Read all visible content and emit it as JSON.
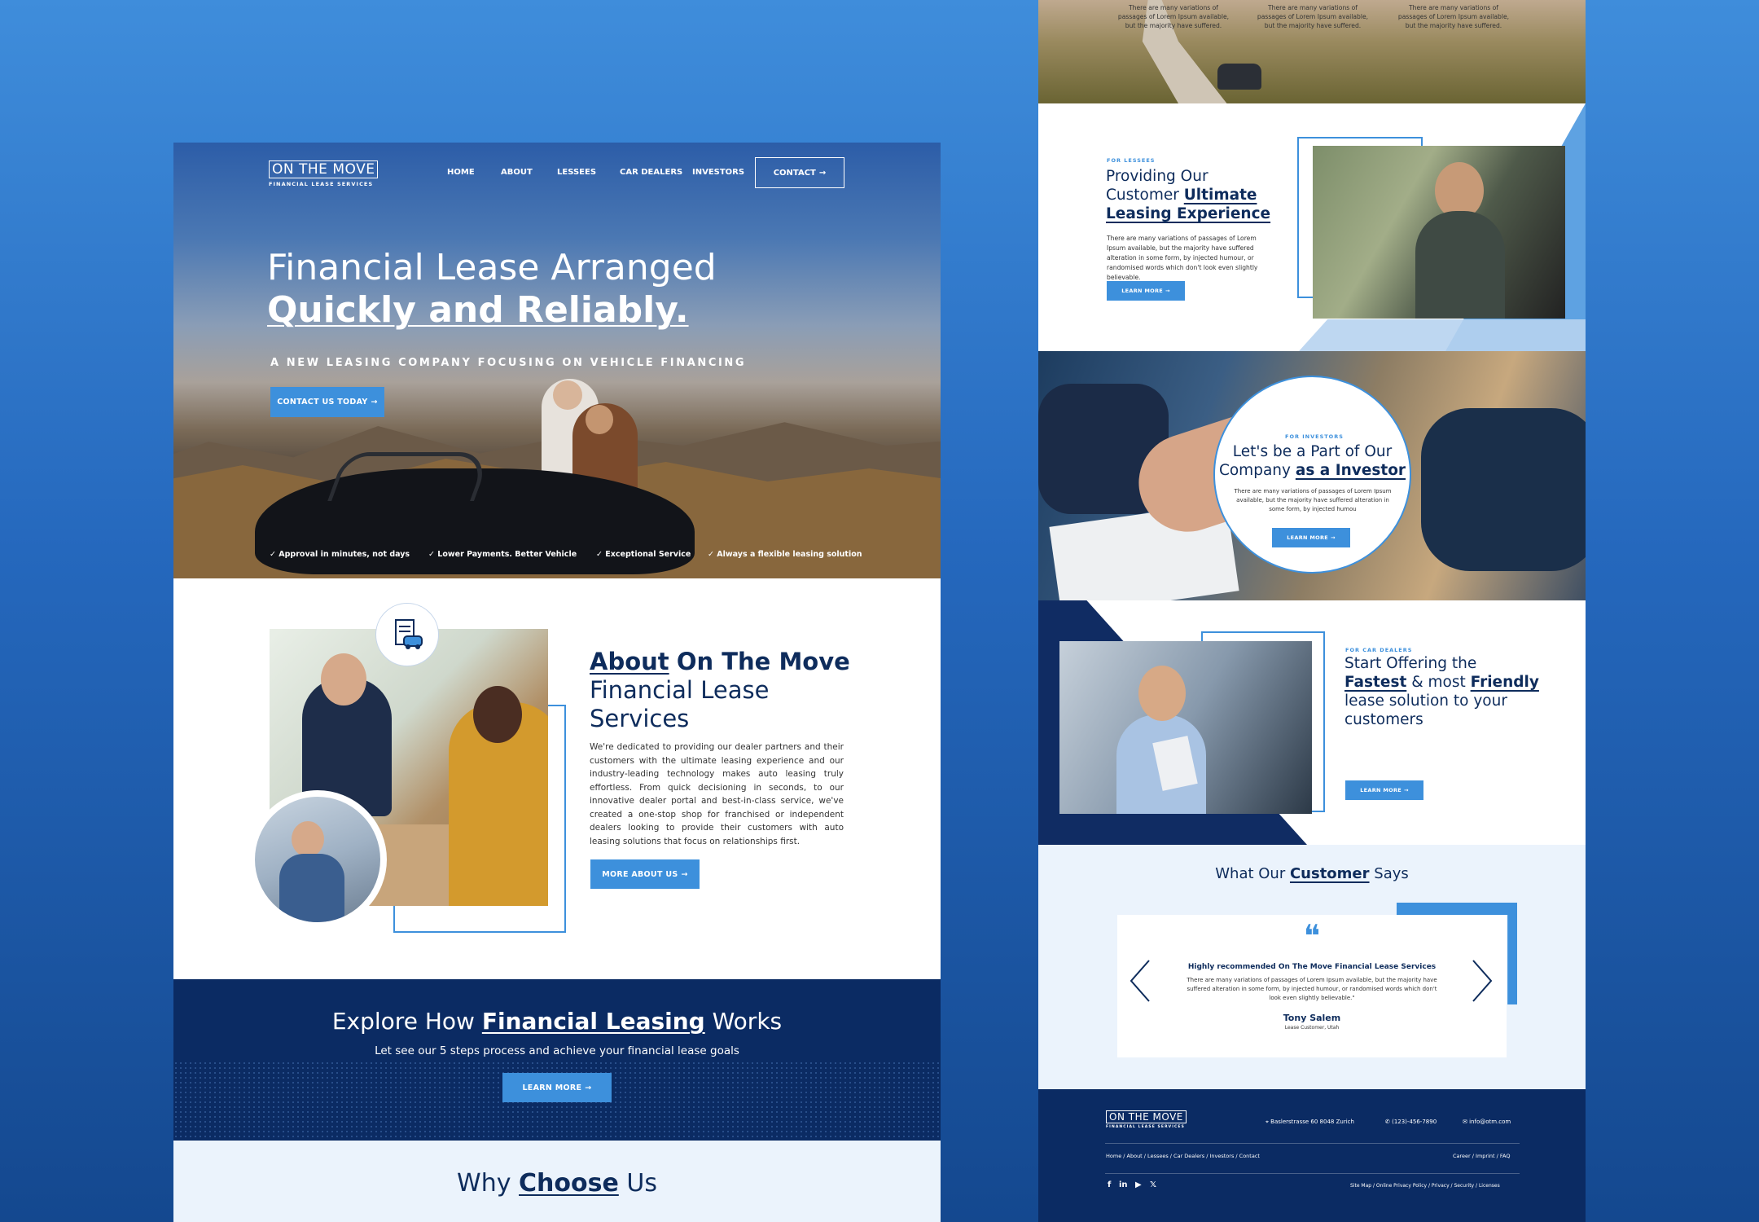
{
  "left": {
    "logo": {
      "title": "ON THE MOVE",
      "subtitle": "FINANCIAL LEASE SERVICES"
    },
    "nav": [
      "HOME",
      "ABOUT",
      "LESSEES",
      "CAR DEALERS",
      "INVESTORS"
    ],
    "contact": "CONTACT",
    "hero": {
      "line1": "Financial Lease Arranged",
      "line2": "Quickly and Reliably.",
      "tagline": "A NEW LEASING COMPANY FOCUSING ON VEHICLE FINANCING",
      "cta": "CONTACT US TODAY",
      "features": [
        "Approval in minutes, not days",
        "Lower Payments. Better Vehicle",
        "Exceptional Service",
        "Always a flexible leasing solution"
      ]
    },
    "about": {
      "title_hl": "About",
      "title_rest": "On The Move",
      "title_line2": "Financial Lease",
      "title_line3": "Services",
      "text": "We're dedicated to providing our dealer partners and their customers with the ultimate leasing experience and our industry-leading technology makes auto leasing truly effortless. From quick decisioning in seconds, to our innovative dealer portal and best-in-class service, we've created a one-stop shop for franchised or independent dealers looking to provide their customers with auto leasing solutions that focus on relationships first.",
      "button": "MORE ABOUT US"
    },
    "explore": {
      "pre": "Explore How",
      "hl": "Financial Leasing",
      "post": "Works",
      "subtitle": "Let see our 5 steps process and achieve your financial lease goals",
      "button": "LEARN MORE"
    },
    "why": {
      "pre": "Why",
      "hl": "Choose",
      "post": "Us"
    }
  },
  "right": {
    "top_texts": [
      "There are many variations of passages of Lorem Ipsum available, but the majority have suffered.",
      "There are many variations of passages of Lorem Ipsum available, but the majority have suffered.",
      "There are many variations of passages of Lorem Ipsum available, but the majority have suffered."
    ],
    "lessees": {
      "tag": "FOR LESSEES",
      "line1": "Providing Our",
      "line2_pre": "Customer",
      "line2_hl": "Ultimate",
      "line3_hl": "Leasing Experience",
      "text": "There are many variations of passages of Lorem Ipsum available, but the majority have suffered alteration in some form, by injected humour, or randomised words which don't look even slightly believable.",
      "button": "LEARN MORE"
    },
    "investors": {
      "tag": "FOR INVESTORS",
      "line1": "Let's be a Part of Our",
      "line2_pre": "Company",
      "line2_hl": "as a Investor",
      "text": "There are many variations of passages of Lorem Ipsum available, but the majority have suffered alteration in some form, by injected humou",
      "button": "LEARN MORE"
    },
    "dealers": {
      "tag": "FOR CAR DEALERS",
      "line1": "Start Offering the",
      "hl1": "Fastest",
      "mid": "& most",
      "hl2": "Friendly",
      "line3": "lease solution to your",
      "line4": "customers",
      "button": "LEARN MORE"
    },
    "testimonial": {
      "pre": "What Our",
      "hl": "Customer",
      "post": "Says",
      "quote_mark": "❝",
      "headline": "Highly recommended On The Move Financial Lease Services",
      "text": "There are many variations of passages of Lorem Ipsum available, but the majority have suffered alteration in some form, by injected humour, or randomised words which don't look even slightly believable.\"",
      "name": "Tony Salem",
      "role": "Lease Customer, Utah"
    },
    "footer": {
      "logo_title": "ON THE MOVE",
      "logo_subtitle": "FINANCIAL LEASE SERVICES",
      "address": "Baslerstrasse 60 8048 Zurich",
      "phone": "(123)-456-7890",
      "email": "info@otm.com",
      "links_left": "Home  /  About  /  Lessees  /  Car Dealers  /  Investors /  Contact",
      "links_right": "Career  /  Imprint  /  FAQ",
      "links_bottom": "Site Map  /  Online Privacy Policy  /  Privacy / Security  /  Licenses",
      "social": [
        "f",
        "in",
        "▶",
        "𝕏"
      ]
    }
  },
  "colors": {
    "navy": "#0b2b63",
    "accent": "#3d90dc",
    "light_bg": "#ebf3fc"
  }
}
